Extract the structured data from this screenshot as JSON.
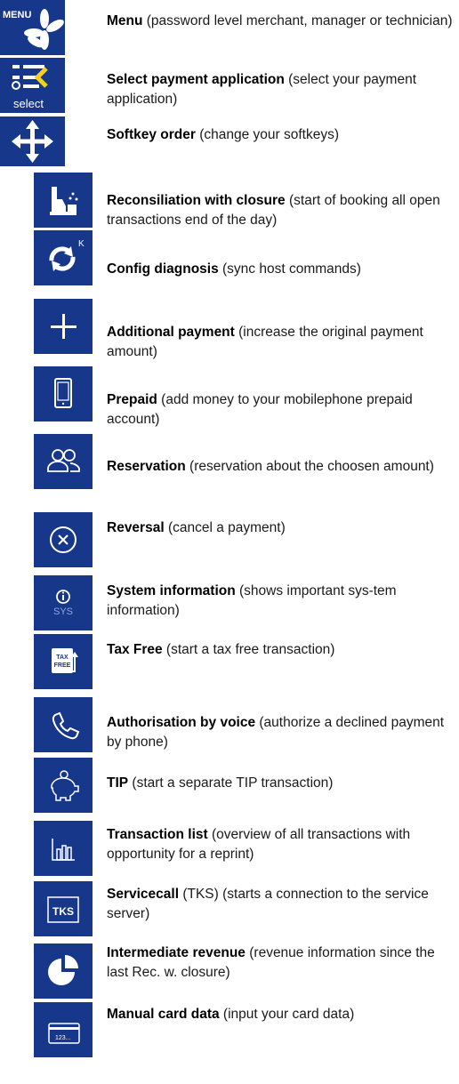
{
  "colors": {
    "tile": "#17378b",
    "tile_light": "#ffffff",
    "accent": "#f5d020"
  },
  "entries": [
    {
      "icon": "menu-icon",
      "title": "Menu",
      "desc": " (password level merchant, manager or technician)",
      "icon_label": "MENU"
    },
    {
      "icon": "select-icon",
      "title": "Select payment application",
      "desc": " (select your payment application)",
      "icon_label": "select"
    },
    {
      "icon": "move-icon",
      "title": "Softkey order",
      "desc": " (change your softkeys)"
    },
    {
      "icon": "cash-register-icon",
      "title": "Reconsiliation with closure",
      "desc": " (start of booking all open transactions end of the day)"
    },
    {
      "icon": "sync-icon",
      "title": "Config diagnosis",
      "desc": " (sync host commands)",
      "icon_label": "K"
    },
    {
      "icon": "plus-icon",
      "title": "Additional payment",
      "desc": " (increase the original payment amount)"
    },
    {
      "icon": "mobile-phone-icon",
      "title": "Prepaid",
      "desc": " (add money to your mobilephone prepaid account)"
    },
    {
      "icon": "people-icon",
      "title": "Reservation",
      "desc": " (reservation about the choosen amount)"
    },
    {
      "icon": "cancel-circle-icon",
      "title": "Reversal",
      "desc": "  (cancel a payment)"
    },
    {
      "icon": "info-icon",
      "title": "System information",
      "desc": " (shows important sys-tem information)",
      "icon_label": "SYS"
    },
    {
      "icon": "tax-free-icon",
      "title": "Tax Free",
      "desc": " (start a tax free transaction)",
      "icon_label": "TAX FREE"
    },
    {
      "icon": "phone-icon",
      "title": "Authorisation by voice",
      "desc": " (authorize a declined payment by phone)"
    },
    {
      "icon": "piggy-bank-icon",
      "title": "TIP",
      "desc": " (start a separate TIP transaction)"
    },
    {
      "icon": "bar-chart-icon",
      "title": "Transaction list",
      "desc": " (overview of all transactions with opportunity for a reprint)"
    },
    {
      "icon": "tks-icon",
      "title": "Servicecall",
      "desc": " (TKS) (starts a connection to the service server)",
      "icon_label": "TKS"
    },
    {
      "icon": "pie-chart-icon",
      "title": "Intermediate revenue",
      "desc": " (revenue information since the last Rec. w. closure)"
    },
    {
      "icon": "card-icon",
      "title": "Manual card data",
      "desc": " (input your card data)",
      "icon_label": "123..."
    }
  ]
}
